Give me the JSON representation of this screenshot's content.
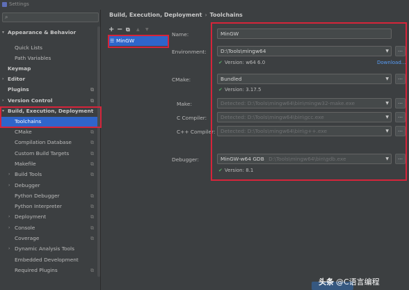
{
  "window": {
    "title": "Settings"
  },
  "sidebar": {
    "search_placeholder": "",
    "items": [
      {
        "label": "Appearance & Behavior",
        "bold": true
      },
      {
        "label": "Quick Lists"
      },
      {
        "label": "Path Variables"
      },
      {
        "label": "Keymap",
        "bold": true
      },
      {
        "label": "Editor",
        "bold": true
      },
      {
        "label": "Plugins",
        "bold": true
      },
      {
        "label": "Version Control",
        "bold": true
      },
      {
        "label": "Build, Execution, Deployment",
        "bold": true
      },
      {
        "label": "Toolchains"
      },
      {
        "label": "CMake"
      },
      {
        "label": "Compilation Database"
      },
      {
        "label": "Custom Build Targets"
      },
      {
        "label": "Makefile"
      },
      {
        "label": "Build Tools"
      },
      {
        "label": "Debugger"
      },
      {
        "label": "Python Debugger"
      },
      {
        "label": "Python Interpreter"
      },
      {
        "label": "Deployment"
      },
      {
        "label": "Console"
      },
      {
        "label": "Coverage"
      },
      {
        "label": "Dynamic Analysis Tools"
      },
      {
        "label": "Embedded Development"
      },
      {
        "label": "Required Plugins"
      }
    ]
  },
  "breadcrumb": {
    "parent": "Build, Execution, Deployment",
    "separator": "›",
    "current": "Toolchains"
  },
  "toolchains": {
    "toolbar": {
      "add": "+",
      "remove": "−",
      "copy": "⧉",
      "up": "▲",
      "down": "▼"
    },
    "items": [
      {
        "label": "MinGW"
      }
    ]
  },
  "form": {
    "name_label": "Name:",
    "name_value": "MinGW",
    "environment_label": "Environment:",
    "environment_value": "D:\\Tools\\mingw64",
    "environment_version": "Version: w64 6.0",
    "download_link": "Download...",
    "cmake_label": "CMake:",
    "cmake_value": "Bundled",
    "cmake_version": "Version: 3.17.5",
    "make_label": "Make:",
    "make_value": "Detected: D:\\Tools\\mingw64\\bin\\mingw32-make.exe",
    "c_compiler_label": "C Compiler:",
    "c_compiler_value": "Detected: D:\\Tools\\mingw64\\bin\\gcc.exe",
    "cpp_compiler_label": "C++ Compiler:",
    "cpp_compiler_value": "Detected: D:\\Tools\\mingw64\\bin\\g++.exe",
    "debugger_label": "Debugger:",
    "debugger_value": "MinGW-w64 GDB",
    "debugger_path": "D:\\Tools\\mingw64\\bin\\gdb.exe",
    "debugger_version": "Version: 8.1",
    "browse_label": "…"
  },
  "watermark": {
    "brand": "头条",
    "handle": "@C语言编程"
  },
  "colors": {
    "accent_selection": "#2f65ca",
    "highlight_box": "#d7243a",
    "check": "#59a869",
    "link": "#589df6"
  }
}
